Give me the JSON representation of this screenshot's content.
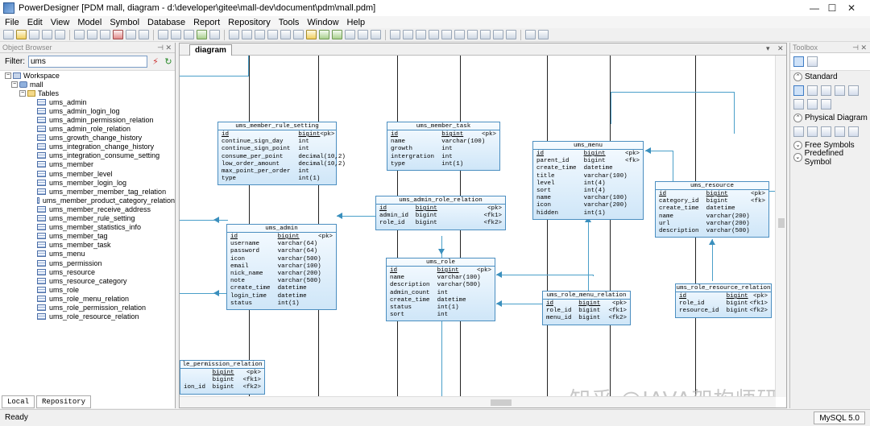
{
  "window": {
    "title": "PowerDesigner [PDM mall, diagram - d:\\developer\\gitee\\mall-dev\\document\\pdm\\mall.pdm]",
    "minimize": "—",
    "maximize": "☐",
    "close": "✕"
  },
  "menu": [
    "File",
    "Edit",
    "View",
    "Model",
    "Symbol",
    "Database",
    "Report",
    "Repository",
    "Tools",
    "Window",
    "Help"
  ],
  "object_browser": {
    "header": "Object Browser",
    "filter_label": "Filter:",
    "filter_value": "ums",
    "workspace": "Workspace",
    "model": "mall",
    "folder": "Tables",
    "tables": [
      "ums_admin",
      "ums_admin_login_log",
      "ums_admin_permission_relation",
      "ums_admin_role_relation",
      "ums_growth_change_history",
      "ums_integration_change_history",
      "ums_integration_consume_setting",
      "ums_member",
      "ums_member_level",
      "ums_member_login_log",
      "ums_member_member_tag_relation",
      "ums_member_product_category_relation",
      "ums_member_receive_address",
      "ums_member_rule_setting",
      "ums_member_statistics_info",
      "ums_member_tag",
      "ums_member_task",
      "ums_menu",
      "ums_permission",
      "ums_resource",
      "ums_resource_category",
      "ums_role",
      "ums_role_menu_relation",
      "ums_role_permission_relation",
      "ums_role_resource_relation"
    ],
    "tabs": [
      "Local",
      "Repository"
    ]
  },
  "diagram": {
    "tab": "diagram",
    "entities": {
      "member_rule_setting": {
        "name": "ums_member_rule_setting",
        "rows": [
          [
            "id",
            "bigint",
            "<pk>"
          ],
          [
            "continue_sign_day",
            "int",
            ""
          ],
          [
            "continue_sign_point",
            "int",
            ""
          ],
          [
            "consume_per_point",
            "decimal(10,2)",
            ""
          ],
          [
            "low_order_amount",
            "decimal(10,2)",
            ""
          ],
          [
            "max_point_per_order",
            "int",
            ""
          ],
          [
            "type",
            "int(1)",
            ""
          ]
        ]
      },
      "member_task": {
        "name": "ums_member_task",
        "rows": [
          [
            "id",
            "bigint",
            "<pk>"
          ],
          [
            "name",
            "varchar(100)",
            ""
          ],
          [
            "growth",
            "int",
            ""
          ],
          [
            "intergration",
            "int",
            ""
          ],
          [
            "type",
            "int(1)",
            ""
          ]
        ]
      },
      "menu": {
        "name": "ums_menu",
        "rows": [
          [
            "id",
            "bigint",
            "<pk>"
          ],
          [
            "parent_id",
            "bigint",
            "<fk>"
          ],
          [
            "create_time",
            "datetime",
            ""
          ],
          [
            "title",
            "varchar(100)",
            ""
          ],
          [
            "level",
            "int(4)",
            ""
          ],
          [
            "sort",
            "int(4)",
            ""
          ],
          [
            "name",
            "varchar(100)",
            ""
          ],
          [
            "icon",
            "varchar(200)",
            ""
          ],
          [
            "hidden",
            "int(1)",
            ""
          ]
        ]
      },
      "resource": {
        "name": "ums_resource",
        "rows": [
          [
            "id",
            "bigint",
            "<pk>"
          ],
          [
            "category_id",
            "bigint",
            "<fk>"
          ],
          [
            "create_time",
            "datetime",
            ""
          ],
          [
            "name",
            "varchar(200)",
            ""
          ],
          [
            "url",
            "varchar(200)",
            ""
          ],
          [
            "description",
            "varchar(500)",
            ""
          ]
        ]
      },
      "admin_role_relation": {
        "name": "ums_admin_role_relation",
        "rows": [
          [
            "id",
            "bigint",
            "<pk>"
          ],
          [
            "admin_id",
            "bigint",
            "<fk1>"
          ],
          [
            "role_id",
            "bigint",
            "<fk2>"
          ]
        ]
      },
      "admin": {
        "name": "ums_admin",
        "rows": [
          [
            "id",
            "bigint",
            "<pk>"
          ],
          [
            "username",
            "varchar(64)",
            ""
          ],
          [
            "password",
            "varchar(64)",
            ""
          ],
          [
            "icon",
            "varchar(500)",
            ""
          ],
          [
            "email",
            "varchar(100)",
            ""
          ],
          [
            "nick_name",
            "varchar(200)",
            ""
          ],
          [
            "note",
            "varchar(500)",
            ""
          ],
          [
            "create_time",
            "datetime",
            ""
          ],
          [
            "login_time",
            "datetime",
            ""
          ],
          [
            "status",
            "int(1)",
            ""
          ]
        ]
      },
      "role": {
        "name": "ums_role",
        "rows": [
          [
            "id",
            "bigint",
            "<pk>"
          ],
          [
            "name",
            "varchar(100)",
            ""
          ],
          [
            "description",
            "varchar(500)",
            ""
          ],
          [
            "admin_count",
            "int",
            ""
          ],
          [
            "create_time",
            "datetime",
            ""
          ],
          [
            "status",
            "int(1)",
            ""
          ],
          [
            "sort",
            "int",
            ""
          ]
        ]
      },
      "role_menu_relation": {
        "name": "ums_role_menu_relation",
        "rows": [
          [
            "id",
            "bigint",
            "<pk>"
          ],
          [
            "role_id",
            "bigint",
            "<fk1>"
          ],
          [
            "menu_id",
            "bigint",
            "<fk2>"
          ]
        ]
      },
      "role_resource_relation": {
        "name": "ums_role_resource_relation",
        "rows": [
          [
            "id",
            "bigint",
            "<pk>"
          ],
          [
            "role_id",
            "bigint",
            "<fk1>"
          ],
          [
            "resource_id",
            "bigint",
            "<fk2>"
          ]
        ]
      },
      "role_permission_relation": {
        "name": "le_permission_relation",
        "rows": [
          [
            "",
            "bigint",
            "<pk>"
          ],
          [
            "",
            "bigint",
            "<fk1>"
          ],
          [
            "ion_id",
            "bigint",
            "<fk2>"
          ]
        ]
      }
    },
    "watermark": "知乎 @JAVA架构师研究会"
  },
  "toolbox": {
    "header": "Toolbox",
    "sections": [
      "Standard",
      "Physical Diagram",
      "Free Symbols",
      "Predefined Symbol"
    ]
  },
  "status": {
    "text": "Ready",
    "dbms": "MySQL 5.0"
  }
}
